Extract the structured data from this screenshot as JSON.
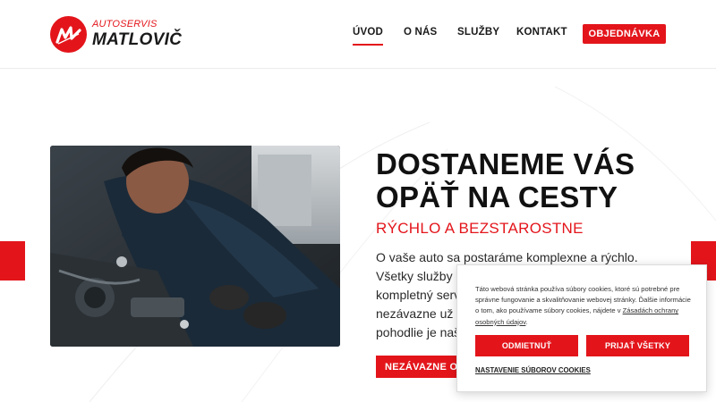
{
  "logo": {
    "small": "AUTOSERVIS",
    "big": "MATLOVIČ",
    "mark_icon": "autoservis-m-logo-icon"
  },
  "nav": {
    "items": [
      {
        "label": "ÚVOD",
        "active": true
      },
      {
        "label": "O NÁS",
        "active": false
      },
      {
        "label": "SLUŽBY",
        "active": false
      },
      {
        "label": "KONTAKT",
        "active": false
      }
    ],
    "cta": "OBJEDNÁVKA"
  },
  "hero": {
    "title_line1": "DOSTANEME VÁS",
    "title_line2": "OPÄŤ NA CESTY",
    "subtitle": "RÝCHLO A BEZSTAROSTNE",
    "desc_lines": [
      "O vaše auto sa postaráme komplexne a rýchlo.",
      "Všetky služby o",
      "kompletný servi",
      "nezávazne už te",
      "pohodlie je našo"
    ],
    "button": "NEZÁVAZNE OBJ",
    "image_icon": "mechanic-photo"
  },
  "cookie": {
    "text_main": "Táto webová stránka používa súbory cookies, ktoré sú potrebné pre správne fungovanie a skvalitňovanie webovej stránky. Ďalšie informácie o tom, ako používame súbory cookies, nájdete v ",
    "link": "Zásadách ochrany osobných údajov",
    "text_end": ".",
    "decline": "ODMIETNUŤ",
    "accept": "PRIJAŤ VŠETKY",
    "settings": "NASTAVENIE SÚBOROV COOKIES"
  },
  "colors": {
    "accent": "#e3151b",
    "text": "#111111"
  }
}
